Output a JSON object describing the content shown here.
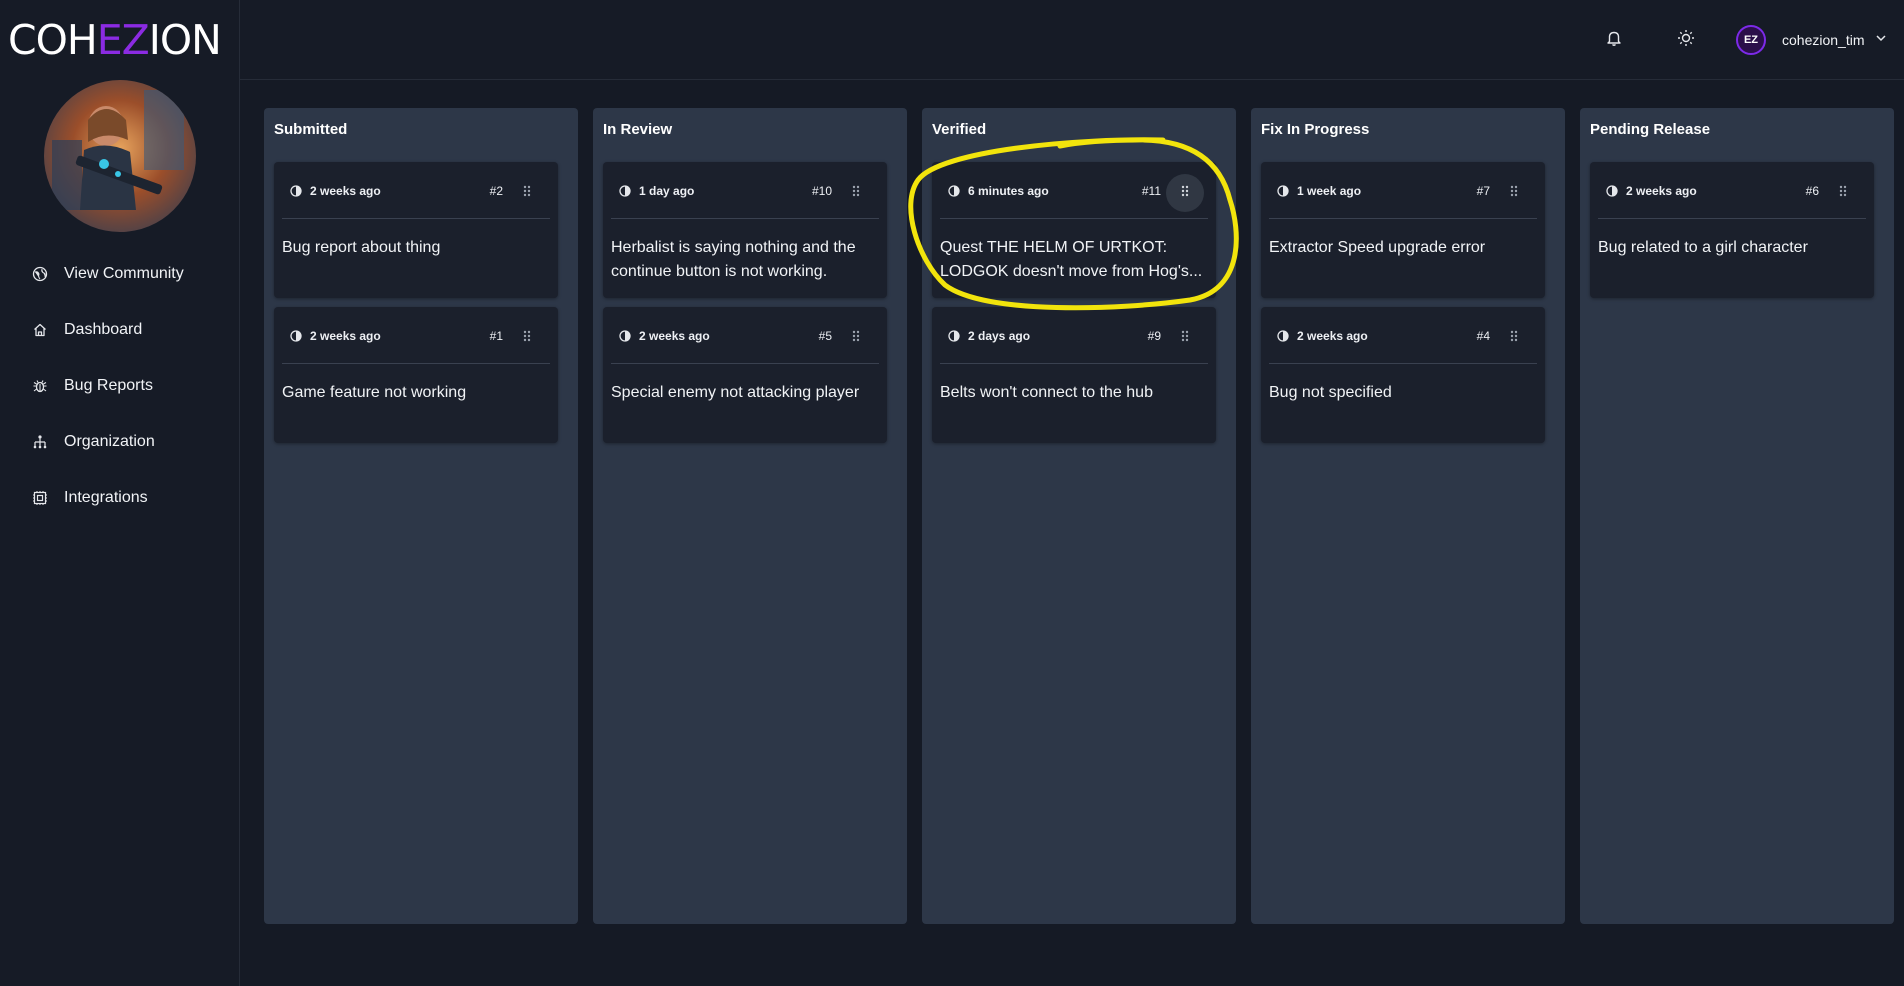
{
  "app": {
    "logo_text_1": "COH",
    "logo_text_accent": "EZ",
    "logo_text_2": "ION"
  },
  "sidebar": {
    "items": [
      {
        "label": "View Community",
        "icon": "globe-icon"
      },
      {
        "label": "Dashboard",
        "icon": "home-icon"
      },
      {
        "label": "Bug Reports",
        "icon": "bug-icon"
      },
      {
        "label": "Organization",
        "icon": "org-chart-icon"
      },
      {
        "label": "Integrations",
        "icon": "integrations-icon"
      }
    ]
  },
  "header": {
    "user": {
      "initials": "EZ",
      "name": "cohezion_tim"
    }
  },
  "board": {
    "columns": [
      {
        "title": "Submitted",
        "cards": [
          {
            "time": "2 weeks ago",
            "number": "#2",
            "text": "Bug report about thing"
          },
          {
            "time": "2 weeks ago",
            "number": "#1",
            "text": "Game feature not working"
          }
        ]
      },
      {
        "title": "In Review",
        "cards": [
          {
            "time": "1 day ago",
            "number": "#10",
            "text": "Herbalist is saying nothing and the continue button is not working."
          },
          {
            "time": "2 weeks ago",
            "number": "#5",
            "text": "Special enemy not attacking player"
          }
        ]
      },
      {
        "title": "Verified",
        "cards": [
          {
            "time": "6 minutes ago",
            "number": "#11",
            "text": "Quest THE HELM OF URTKOT: LODGOK doesn't move from Hog's..."
          },
          {
            "time": "2 days ago",
            "number": "#9",
            "text": "Belts won't connect to the hub"
          }
        ]
      },
      {
        "title": "Fix In Progress",
        "cards": [
          {
            "time": "1 week ago",
            "number": "#7",
            "text": "Extractor Speed upgrade error"
          },
          {
            "time": "2 weeks ago",
            "number": "#4",
            "text": "Bug not specified"
          }
        ]
      },
      {
        "title": "Pending Release",
        "cards": [
          {
            "time": "2 weeks ago",
            "number": "#6",
            "text": "Bug related to a girl character"
          }
        ]
      }
    ]
  },
  "colors": {
    "accent": "#8b2be2",
    "highlight": "#f2e40c",
    "column_bg": "#2d3748",
    "card_bg": "#1b202c"
  }
}
